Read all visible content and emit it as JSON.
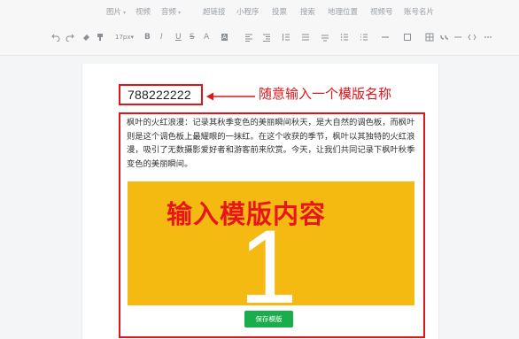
{
  "toolbar": {
    "tabs": [
      {
        "label": "图片",
        "caret": "▾"
      },
      {
        "label": "视频"
      },
      {
        "label": "音频",
        "caret": "▾"
      },
      {
        "label": "超链接"
      },
      {
        "label": "小程序"
      },
      {
        "label": "投票"
      },
      {
        "label": "搜索"
      },
      {
        "label": "地理位置"
      },
      {
        "label": "视频号"
      },
      {
        "label": "账号名片"
      }
    ],
    "font_size": "17px",
    "font_size_caret": "▾",
    "bold": "B",
    "italic": "I",
    "underline": "U",
    "strike": "S",
    "font_color": "A",
    "bg_color": "A"
  },
  "template": {
    "name": "788222222",
    "paragraph": "枫叶的火红浪漫：记录其秋季变色的美丽瞬间秋天，是大自然的调色板，而枫叶则是这个调色板上最耀眼的一抹红。在这个收获的季节，枫叶以其独特的火红浪漫，吸引了无数摄影爱好者和游客前来欣赏。今天，让我们共同记录下枫叶秋季变色的美丽瞬间。",
    "banner_text": "输入模版内容",
    "banner_number": "1",
    "save_label": "保存模版"
  },
  "annotations": {
    "title_hint": "随意输入一个模版名称"
  },
  "colors": {
    "annotation_red": "#e0151c",
    "banner_yellow": "#f5ba12",
    "save_green": "#1aad4b"
  }
}
